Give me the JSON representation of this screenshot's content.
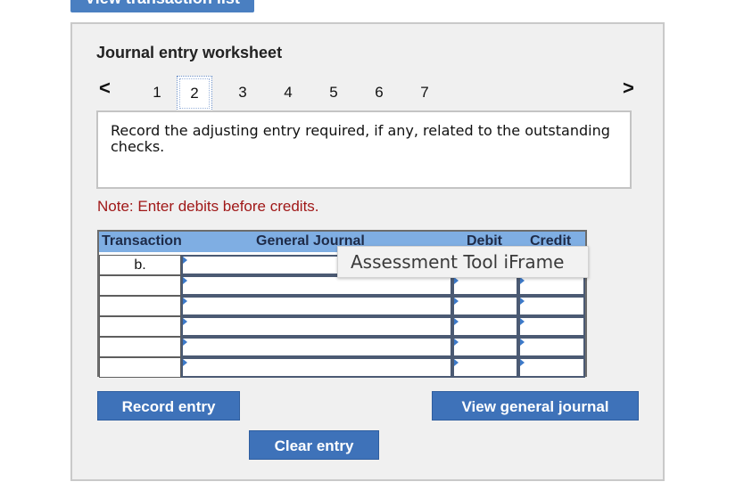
{
  "top_tab": {
    "label": "View transaction list"
  },
  "worksheet": {
    "title": "Journal entry worksheet",
    "nav": {
      "prev_glyph": "<",
      "next_glyph": ">",
      "pages": [
        "1",
        "2",
        "3",
        "4",
        "5",
        "6",
        "7"
      ],
      "current_page": "2"
    },
    "instruction": "Record the adjusting entry required, if any, related to the outstanding checks.",
    "note": "Note: Enter debits before credits.",
    "table": {
      "headers": {
        "transaction": "Transaction",
        "general_journal": "General Journal",
        "debit": "Debit",
        "credit": "Credit"
      },
      "rows": [
        {
          "transaction": "b.",
          "account": "",
          "debit": "",
          "credit": ""
        },
        {
          "transaction": "",
          "account": "",
          "debit": "",
          "credit": ""
        },
        {
          "transaction": "",
          "account": "",
          "debit": "",
          "credit": ""
        },
        {
          "transaction": "",
          "account": "",
          "debit": "",
          "credit": ""
        },
        {
          "transaction": "",
          "account": "",
          "debit": "",
          "credit": ""
        },
        {
          "transaction": "",
          "account": "",
          "debit": "",
          "credit": ""
        }
      ]
    },
    "tooltip": "Assessment Tool iFrame",
    "buttons": {
      "record": "Record entry",
      "view_journal": "View general journal",
      "clear": "Clear entry"
    }
  },
  "colors": {
    "button_blue": "#3e72b9",
    "header_blue": "#7faee3",
    "note_red": "#a01818"
  }
}
